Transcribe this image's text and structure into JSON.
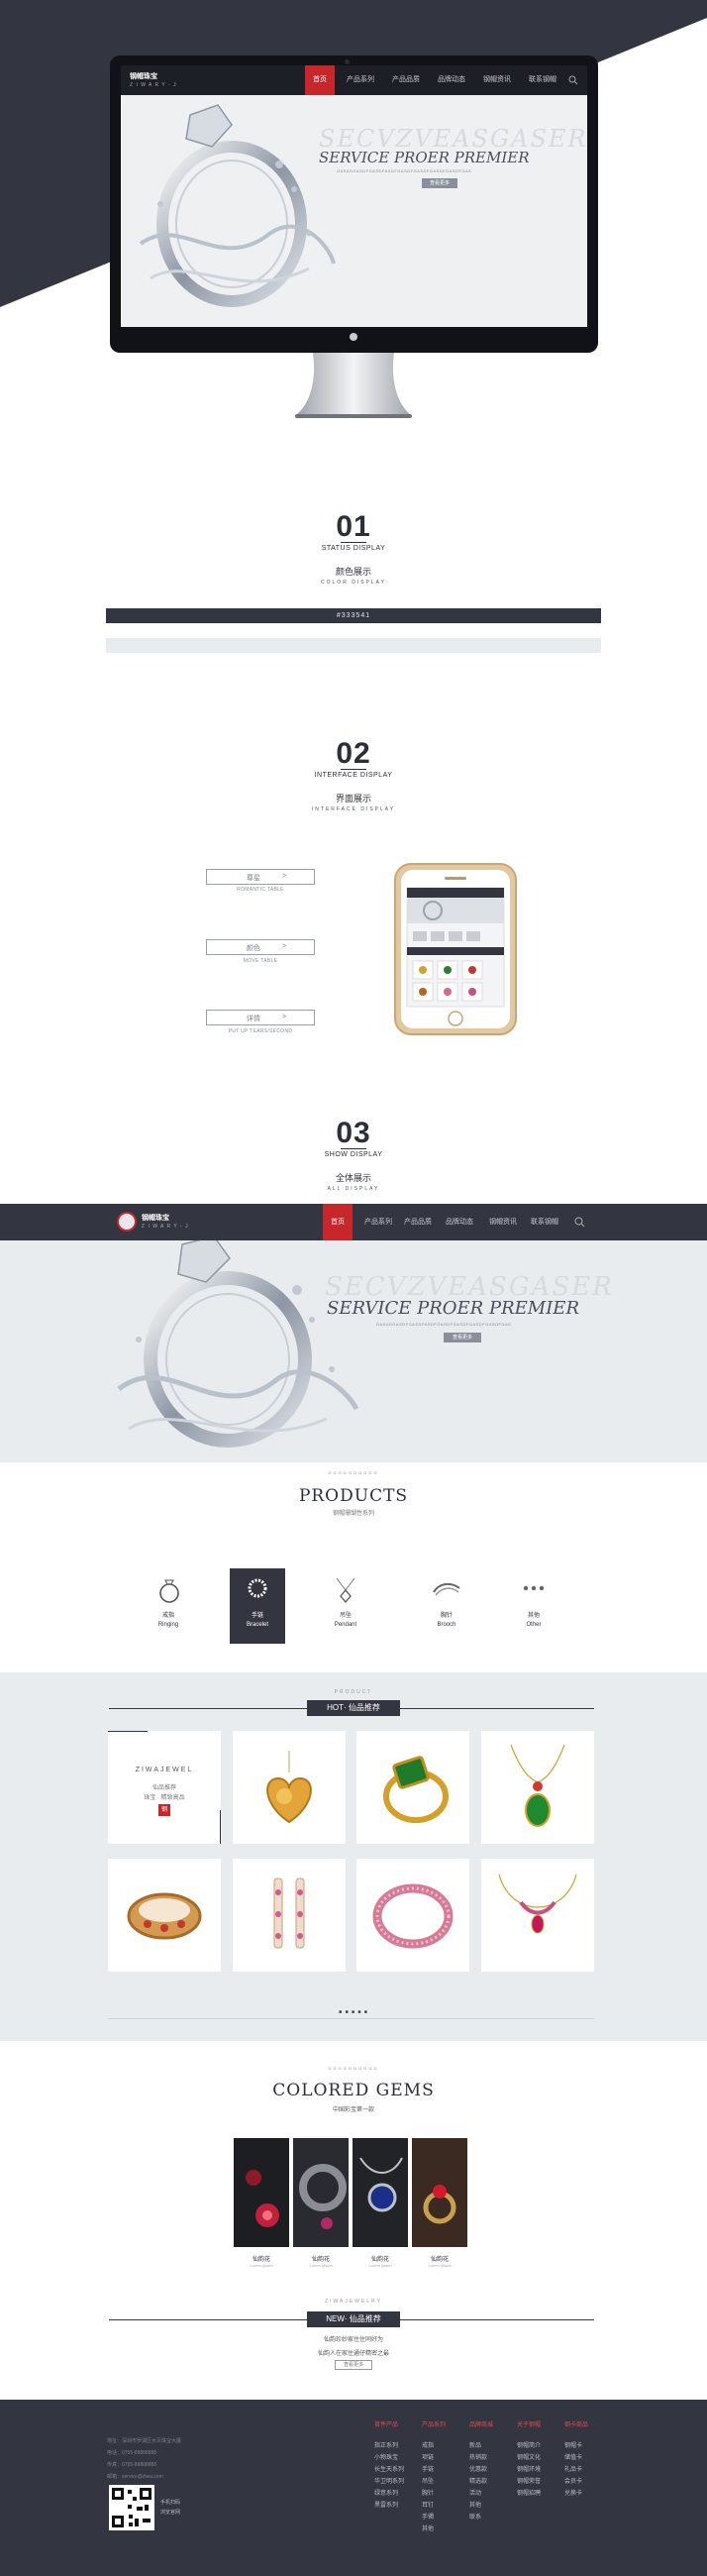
{
  "hero": {
    "logo_cn": "钢帽珠宝",
    "logo_en": "Z I W A R Y - J",
    "nav": [
      "首页",
      "产品系列",
      "产品品质",
      "品牌动态",
      "钢帽资讯",
      "联系钢帽"
    ],
    "banner_line1": "SECVZVEASGASER",
    "banner_line2": "SERVICE PROER PREMIER",
    "banner_line3": "GASASGASDFGASDFASDFGASDFGASDFGASDFGASDFGAS",
    "banner_button": "查看更多"
  },
  "section1": {
    "num": "01",
    "en": "STATUS DISPLAY",
    "cn": "颜色展示",
    "sub": "COLOR DISPLAY",
    "swatch_label": "#333541",
    "swatch_color": "#333541",
    "light_color": "#e9ecef"
  },
  "section2": {
    "num": "02",
    "en": "INTERFACE DISPLAY",
    "cn": "界面展示",
    "sub": "INTERFACE DISPLAY",
    "buttons": [
      {
        "label": "尊星",
        "arrow": ">",
        "caption": "ROMANTIC TABLE"
      },
      {
        "label": "颜色",
        "arrow": ">",
        "caption": "MOVE TABLE"
      },
      {
        "label": "详情",
        "arrow": ">",
        "caption": "PUT UP TEARS/SECOND"
      }
    ]
  },
  "section3": {
    "num": "03",
    "en": "SHOW DISPLAY",
    "cn": "全体展示",
    "sub": "ALL DISPLAY"
  },
  "preview": {
    "logo_cn": "钢帽珠宝",
    "logo_en": "Z I W A R Y - J",
    "nav": [
      "首页",
      "产品系列",
      "产品品质",
      "品牌动态",
      "钢帽资讯",
      "联系钢帽"
    ],
    "banner_line1": "SECVZVEASGASER",
    "banner_line2": "SERVICE PROER PREMIER",
    "banner_line3": "GASASGASDFGASDFASDFGASDFGASDFGASDFGASDFGAS",
    "banner_button": "查看更多",
    "products_small": "GGGGGGGGGG",
    "products_title": "PRODUCTS",
    "products_cn": "钢帽珊瑚性系列",
    "categories": [
      {
        "cn": "戒指",
        "en": "Ringing",
        "icon": "ring-icon"
      },
      {
        "cn": "手链",
        "en": "Bracelet",
        "icon": "bracelet-icon"
      },
      {
        "cn": "吊坠",
        "en": "Pendant",
        "icon": "pendant-icon"
      },
      {
        "cn": "胸针",
        "en": "Brooch",
        "icon": "brooch-icon"
      },
      {
        "cn": "其他",
        "en": "Other",
        "icon": "other-icon"
      }
    ],
    "hot_small": "PRODUCT",
    "hot_label": "HOT· 仙品推荐",
    "featured": {
      "en": "ZIWAJEWEL",
      "cn1": "仙品推荐",
      "cn2": "珠宝 · 精致高品",
      "badge": "钢"
    },
    "pager": "■ ■ ■ ■ ■",
    "gems_small": "GGGGGGGGGG",
    "gems_title": "COLORED GEMS",
    "gems_cn": "中国彩宝第一款",
    "gem_captions": [
      "仙韵花",
      "仙韵花",
      "仙韵花",
      "仙韵花"
    ],
    "gem_caption_small": "Lorem ipsum",
    "new_small": "ZIWAJEWELRY",
    "new_label": "NEW· 仙品推荐",
    "new_text1": "仙韵珍妙家住住同好为",
    "new_text2": "仙韵人在家住通仔精密之最",
    "new_button": "查看更多"
  },
  "footer": {
    "info": [
      "地址：深圳市罗湖区水贝珠宝大厦",
      "电话：0755-88888888",
      "传真：0755-88888888",
      "邮箱：service@ziwa.com"
    ],
    "qr_caption1": "手机扫码",
    "qr_caption2": "浏览官网",
    "columns": [
      {
        "title": "首件产品",
        "links": [
          "指正系列",
          "小物珠宝",
          "长生天系列",
          "华卫明系列",
          "绿意系列",
          "黑雷系列"
        ]
      },
      {
        "title": "产品系列",
        "links": [
          "戒指",
          "项链",
          "手链",
          "吊坠",
          "胸针",
          "耳钉",
          "手镯",
          "其他"
        ]
      },
      {
        "title": "品牌商城",
        "links": [
          "新品",
          "热销款",
          "优惠款",
          "精选款",
          "活动",
          "其他",
          "联系"
        ]
      },
      {
        "title": "关于钢帽",
        "links": [
          "钢帽简介",
          "钢帽文化",
          "钢帽环境",
          "钢帽荣誉",
          "钢帽招聘"
        ]
      },
      {
        "title": "钢卡商品",
        "links": [
          "钢帽卡",
          "储值卡",
          "礼品卡",
          "会员卡",
          "兑换卡"
        ]
      }
    ]
  }
}
